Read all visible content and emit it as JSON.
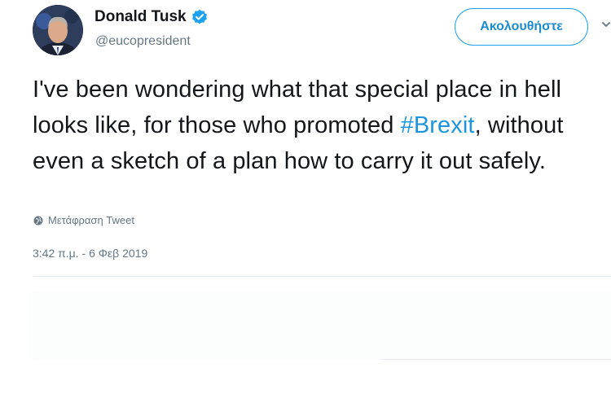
{
  "user": {
    "display_name": "Donald Tusk",
    "handle": "@eucopresident",
    "verified": true
  },
  "follow_button": {
    "label": "Ακολουθήστε"
  },
  "tweet": {
    "text_before_hashtag": "I've been wondering what that special place in hell looks like, for those who promoted ",
    "hashtag": "#Brexit",
    "text_after_hashtag": ", without even a sketch of a plan how to carry it out safely.",
    "translate_label": "Μετάφραση Tweet",
    "timestamp": "3:42 π.μ. - 6 Φεβ 2019"
  },
  "colors": {
    "accent": "#1da1f2",
    "hashtag": "#1b95e0",
    "text": "#14171a",
    "secondary": "#657786",
    "verified": "#1da1f2"
  },
  "icons": {
    "verified": "verified-badge-icon",
    "translate": "globe-icon",
    "menu": "chevron-down-icon"
  }
}
